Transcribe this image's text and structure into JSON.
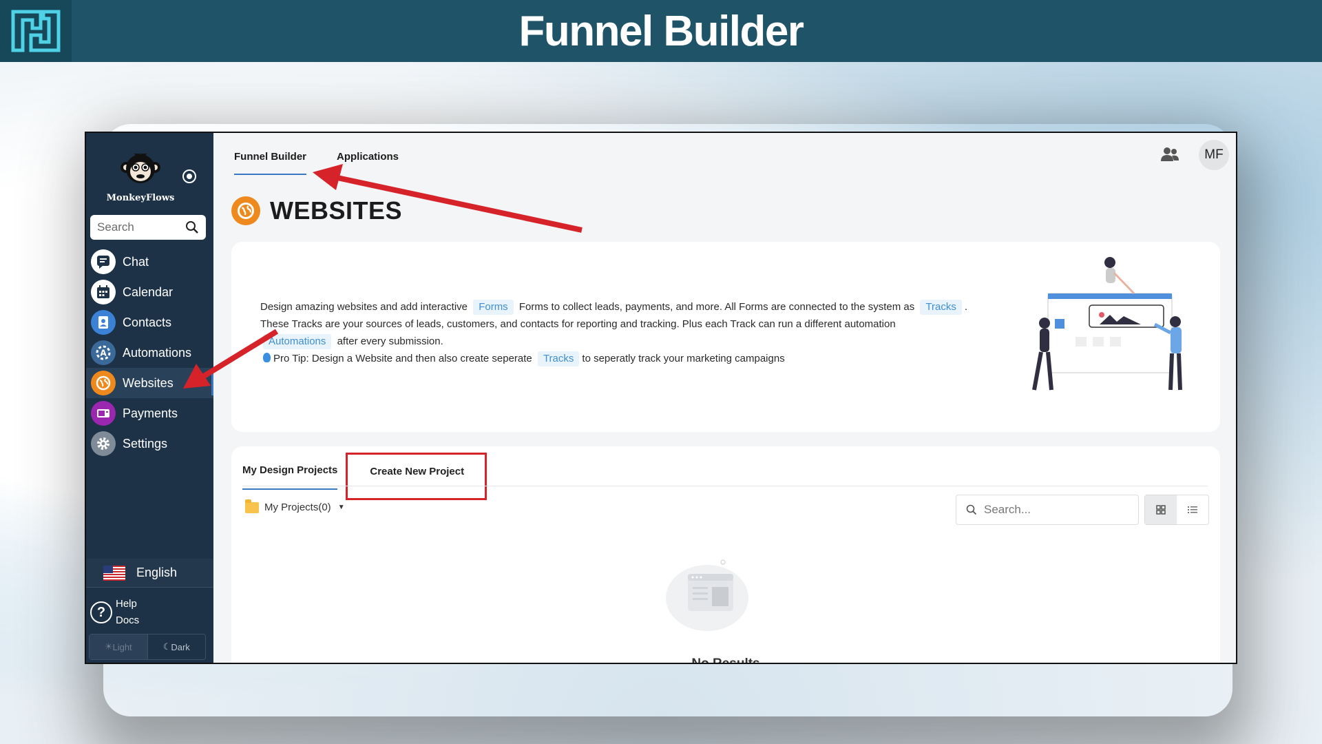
{
  "banner": {
    "title": "Funnel Builder",
    "logo_icon": "maze-logo-icon"
  },
  "sidebar": {
    "brand_name": "MonkeyFlows",
    "search_placeholder": "Search",
    "items": [
      {
        "label": "Chat",
        "icon": "chat-icon",
        "color": "#1d3247"
      },
      {
        "label": "Calendar",
        "icon": "calendar-icon",
        "color": "#1d3247"
      },
      {
        "label": "Contacts",
        "icon": "contacts-icon",
        "color": "#3b82d6"
      },
      {
        "label": "Automations",
        "icon": "automations-icon",
        "color": "#3b6a9a"
      },
      {
        "label": "Websites",
        "icon": "globe-icon",
        "color": "#ee8a1d",
        "active": true
      },
      {
        "label": "Payments",
        "icon": "payments-icon",
        "color": "#9b27b0"
      },
      {
        "label": "Settings",
        "icon": "gear-icon",
        "color": "#7f8b96"
      }
    ],
    "language": "English",
    "help_line1": "Help",
    "help_line2": "Docs",
    "theme_light": "Light",
    "theme_dark": "Dark"
  },
  "topnav": {
    "tabs": [
      {
        "label": "Funnel Builder",
        "active": true
      },
      {
        "label": "Applications",
        "active": false
      }
    ],
    "avatar_initials": "MF"
  },
  "page": {
    "title": "WEBSITES",
    "info": {
      "p1_a": "Design amazing websites and add interactive",
      "chip_forms": "Forms",
      "p1_b": "Forms to collect leads, payments, and more. All Forms are connected to the system as",
      "chip_tracks": "Tracks",
      "p1_c": ".",
      "p2_a": "These Tracks are your sources of leads, customers, and contacts for reporting and tracking. Plus each Track can run a different automation",
      "chip_automations": "Automations",
      "p2_b": "after every submission.",
      "tip_a": "Pro Tip: Design a Website and then also create seperate",
      "chip_tracks2": "Tracks",
      "tip_b": "to seperatly track your marketing campaigns"
    }
  },
  "projects": {
    "tab_mine": "My Design Projects",
    "tab_create": "Create New Project",
    "folder_label": "My Projects(0)",
    "search_placeholder": "Search...",
    "empty_text": "No Results"
  },
  "colors": {
    "banner": "#1f5468",
    "sidebar": "#1d3247",
    "accent": "#3b78c4",
    "highlight": "#d6232a"
  }
}
